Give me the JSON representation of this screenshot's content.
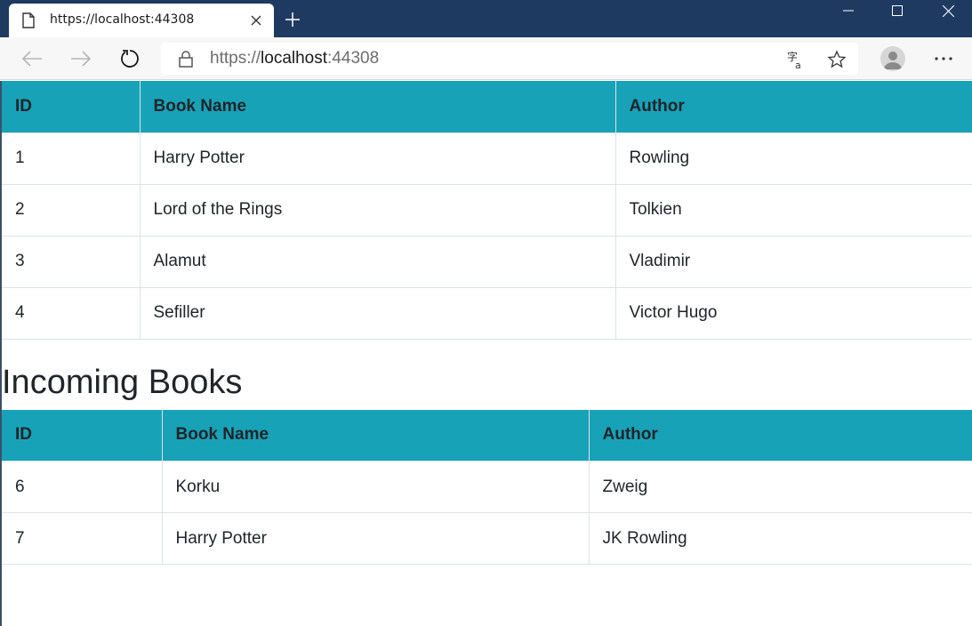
{
  "browser": {
    "tab_title": "https://localhost:44308",
    "url_scheme": "https://",
    "url_host": "localhost",
    "url_port": ":44308",
    "icons": [
      "page-icon",
      "close-icon",
      "plus-icon",
      "minimize-icon",
      "maximize-icon",
      "window-close-icon",
      "back-arrow-icon",
      "forward-arrow-icon",
      "refresh-icon",
      "lock-icon",
      "translate-icon",
      "star-icon",
      "profile-icon",
      "more-icon"
    ]
  },
  "books_table": {
    "headers": [
      "ID",
      "Book Name",
      "Author"
    ],
    "rows": [
      [
        "1",
        "Harry Potter",
        "Rowling"
      ],
      [
        "2",
        "Lord of the Rings",
        "Tolkien"
      ],
      [
        "3",
        "Alamut",
        "Vladimir"
      ],
      [
        "4",
        "Sefiller",
        "Victor Hugo"
      ]
    ]
  },
  "incoming": {
    "heading": "Incoming Books",
    "headers": [
      "ID",
      "Book Name",
      "Author"
    ],
    "rows": [
      [
        "6",
        "Korku",
        "Zweig"
      ],
      [
        "7",
        "Harry Potter",
        "JK Rowling"
      ]
    ]
  },
  "colors": {
    "header_bg": "#17a2b8",
    "titlebar": "#1f3a61"
  }
}
